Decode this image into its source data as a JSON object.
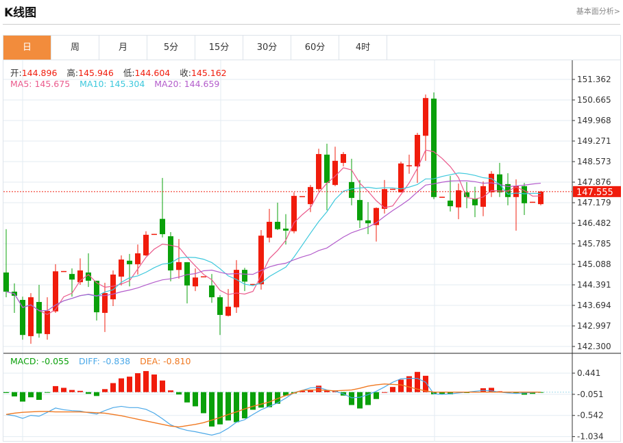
{
  "header": {
    "title": "K线图",
    "link": "基本面分析>"
  },
  "tabs": [
    {
      "label": "日",
      "active": true
    },
    {
      "label": "周"
    },
    {
      "label": "月"
    },
    {
      "label": "5分"
    },
    {
      "label": "15分"
    },
    {
      "label": "30分"
    },
    {
      "label": "60分"
    },
    {
      "label": "4时"
    }
  ],
  "ohlc_legend": {
    "open_label": "开:",
    "open": "144.896",
    "high_label": "高:",
    "high": "145.946",
    "low_label": "低:",
    "low": "144.604",
    "close_label": "收:",
    "close": "145.162"
  },
  "ma_legend": {
    "ma5": "MA5: 145.675",
    "ma10": "MA10: 145.304",
    "ma20": "MA20: 144.659"
  },
  "macd_legend": {
    "macd": "MACD: -0.055",
    "diff": "DIFF: -0.838",
    "dea": "DEA: -0.810"
  },
  "colors": {
    "up": "#f01c0c",
    "down": "#0aa00a",
    "ma5": "#ea5a8c",
    "ma10": "#3cc8dc",
    "ma20": "#b35ccb",
    "diff": "#4aa8e8",
    "dea": "#f07820",
    "accent": "#f28c3c"
  },
  "chart_data": [
    {
      "type": "candlestick",
      "current_price": "147.555",
      "y_ticks": [
        "151.362",
        "150.665",
        "149.968",
        "149.271",
        "148.573",
        "147.876",
        "147.179",
        "146.482",
        "145.785",
        "145.088",
        "144.391",
        "143.694",
        "142.997",
        "142.300"
      ],
      "ylim": [
        142.3,
        151.362
      ],
      "ohlc": [
        [
          144.81,
          146.28,
          143.97,
          144.16
        ],
        [
          144.16,
          144.44,
          143.44,
          144.02
        ],
        [
          143.88,
          143.99,
          142.53,
          142.69
        ],
        [
          142.65,
          144.11,
          142.39,
          143.97
        ],
        [
          143.81,
          144.39,
          142.6,
          142.74
        ],
        [
          142.72,
          143.97,
          142.53,
          143.51
        ],
        [
          143.49,
          145.09,
          143.44,
          144.85
        ],
        [
          144.84,
          144.86,
          144.84,
          144.86
        ],
        [
          144.76,
          144.95,
          143.99,
          144.57
        ],
        [
          144.48,
          145.29,
          144.39,
          144.88
        ],
        [
          144.81,
          145.46,
          144.32,
          144.53
        ],
        [
          144.53,
          144.53,
          143.18,
          143.46
        ],
        [
          143.44,
          144.46,
          142.79,
          144.11
        ],
        [
          143.9,
          144.88,
          143.67,
          144.74
        ],
        [
          144.67,
          145.39,
          144.37,
          145.25
        ],
        [
          145.21,
          145.44,
          144.34,
          145.09
        ],
        [
          145.09,
          145.76,
          144.74,
          145.46
        ],
        [
          145.39,
          146.21,
          145.37,
          146.09
        ],
        [
          146.1,
          146.12,
          146.1,
          146.12
        ],
        [
          146.63,
          148.02,
          146.0,
          146.11
        ],
        [
          146.04,
          146.18,
          144.51,
          144.88
        ],
        [
          144.896,
          145.946,
          144.604,
          145.162
        ],
        [
          145.16,
          145.16,
          143.76,
          144.37
        ],
        [
          144.34,
          144.95,
          144.18,
          144.64
        ],
        [
          144.66,
          144.68,
          144.66,
          144.68
        ],
        [
          144.37,
          144.76,
          143.78,
          143.97
        ],
        [
          143.97,
          144.04,
          142.69,
          143.37
        ],
        [
          143.34,
          144.25,
          143.32,
          143.65
        ],
        [
          143.63,
          145.23,
          143.44,
          144.9
        ],
        [
          144.9,
          144.97,
          144.18,
          144.5
        ],
        [
          144.4,
          144.42,
          144.4,
          144.42
        ],
        [
          144.41,
          146.25,
          144.23,
          146.06
        ],
        [
          145.99,
          146.97,
          145.83,
          146.53
        ],
        [
          146.53,
          147.18,
          146.25,
          146.28
        ],
        [
          146.3,
          146.79,
          145.76,
          146.23
        ],
        [
          146.21,
          147.53,
          146.14,
          147.41
        ],
        [
          147.38,
          147.4,
          147.38,
          147.4
        ],
        [
          147.13,
          147.78,
          146.86,
          147.71
        ],
        [
          147.64,
          149.01,
          147.55,
          148.83
        ],
        [
          148.81,
          149.18,
          146.92,
          147.85
        ],
        [
          147.78,
          149.08,
          147.74,
          148.6
        ],
        [
          148.53,
          148.9,
          148.41,
          148.83
        ],
        [
          147.88,
          148.67,
          147.09,
          147.34
        ],
        [
          147.27,
          147.95,
          146.32,
          146.58
        ],
        [
          146.58,
          147.2,
          146.11,
          146.48
        ],
        [
          146.42,
          147.02,
          145.86,
          147.0
        ],
        [
          146.97,
          147.95,
          146.81,
          147.64
        ],
        [
          147.63,
          147.65,
          147.63,
          147.65
        ],
        [
          147.53,
          148.57,
          147.53,
          148.51
        ],
        [
          148.43,
          148.81,
          148.16,
          148.45
        ],
        [
          148.41,
          149.55,
          147.85,
          149.48
        ],
        [
          149.45,
          150.85,
          148.6,
          150.73
        ],
        [
          150.71,
          150.92,
          147.3,
          147.37
        ],
        [
          147.36,
          147.38,
          147.36,
          147.38
        ],
        [
          147.25,
          148.09,
          146.88,
          147.06
        ],
        [
          147.02,
          147.83,
          146.62,
          147.6
        ],
        [
          147.53,
          147.88,
          146.99,
          147.37
        ],
        [
          147.32,
          147.72,
          146.69,
          147.09
        ],
        [
          147.04,
          147.9,
          146.72,
          147.74
        ],
        [
          147.53,
          148.25,
          147.37,
          148.16
        ],
        [
          148.14,
          148.53,
          147.37,
          147.53
        ],
        [
          147.81,
          148.18,
          147.09,
          147.37
        ],
        [
          147.37,
          147.97,
          146.23,
          147.74
        ],
        [
          147.74,
          147.85,
          146.76,
          147.16
        ],
        [
          147.19,
          147.21,
          147.19,
          147.21
        ],
        [
          147.13,
          147.58,
          147.09,
          147.555
        ]
      ]
    },
    {
      "type": "bar+line",
      "name": "MACD",
      "y_ticks": [
        "0.441",
        "-0.051",
        "-0.542",
        "-1.034"
      ],
      "macd": [
        -0.02,
        -0.1,
        -0.22,
        -0.12,
        -0.18,
        -0.01,
        0.14,
        0.1,
        0.05,
        0.03,
        -0.04,
        -0.09,
        0.07,
        0.21,
        0.32,
        0.36,
        0.44,
        0.49,
        0.41,
        0.27,
        0.04,
        -0.055,
        -0.24,
        -0.33,
        -0.49,
        -0.8,
        -0.75,
        -0.66,
        -0.7,
        -0.61,
        -0.41,
        -0.36,
        -0.35,
        -0.27,
        -0.08,
        -0.03,
        0.03,
        0.04,
        0.15,
        0.05,
        0.04,
        -0.08,
        -0.3,
        -0.38,
        -0.3,
        -0.16,
        0,
        0.12,
        0.29,
        0.37,
        0.47,
        0.38,
        -0.05,
        -0.05,
        -0.05,
        0.01,
        -0.02,
        0.01,
        0.09,
        0.1,
        0.02,
        -0.01,
        -0.02,
        -0.06,
        -0.04,
        -0.01
      ],
      "diff": [
        -0.52,
        -0.55,
        -0.61,
        -0.54,
        -0.56,
        -0.47,
        -0.37,
        -0.41,
        -0.43,
        -0.44,
        -0.48,
        -0.51,
        -0.43,
        -0.36,
        -0.33,
        -0.36,
        -0.36,
        -0.4,
        -0.49,
        -0.62,
        -0.76,
        -0.838,
        -0.89,
        -0.92,
        -0.96,
        -1.0,
        -0.95,
        -0.84,
        -0.7,
        -0.64,
        -0.52,
        -0.41,
        -0.33,
        -0.25,
        -0.14,
        -0.01,
        0.04,
        0.1,
        0.11,
        0.05,
        0.02,
        -0.04,
        -0.13,
        -0.12,
        -0.06,
        0.02,
        0.12,
        0.23,
        0.31,
        0.32,
        0.32,
        0.23,
        -0.04,
        -0.05,
        -0.04,
        -0.02,
        0,
        0.02,
        0.04,
        0.03,
        0,
        -0.02,
        -0.03,
        -0.02,
        -0.01,
        0
      ],
      "dea": [
        -0.52,
        -0.49,
        -0.47,
        -0.46,
        -0.45,
        -0.45,
        -0.46,
        -0.46,
        -0.46,
        -0.46,
        -0.47,
        -0.48,
        -0.49,
        -0.52,
        -0.55,
        -0.59,
        -0.63,
        -0.67,
        -0.71,
        -0.75,
        -0.79,
        -0.81,
        -0.78,
        -0.75,
        -0.71,
        -0.65,
        -0.59,
        -0.52,
        -0.46,
        -0.39,
        -0.33,
        -0.28,
        -0.23,
        -0.15,
        -0.08,
        -0.02,
        0.04,
        0.05,
        0.05,
        0.04,
        0.03,
        0.04,
        0.05,
        0.09,
        0.14,
        0.17,
        0.19,
        0.18,
        0.17,
        0.12,
        0.07,
        0.03,
        0,
        0,
        0,
        0,
        0,
        0,
        0,
        0,
        0,
        0,
        0,
        0,
        0,
        0
      ]
    }
  ]
}
